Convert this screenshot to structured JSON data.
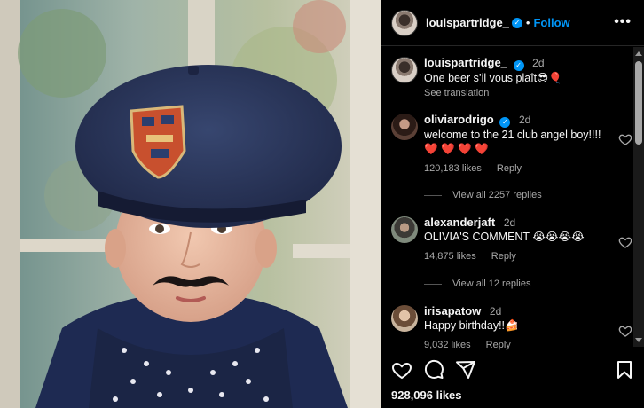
{
  "post": {
    "username": "louispartridge_",
    "follow_label": "Follow",
    "more_label": "•••",
    "likes": "928,096 likes"
  },
  "caption": {
    "username": "louispartridge_",
    "time": "2d",
    "text": "One beer s’il vous plaît😎🎈",
    "see_translation": "See translation"
  },
  "comments": [
    {
      "username": "oliviarodrigo",
      "time": "2d",
      "text": "welcome to the 21 club angel boy!!!! ❤️ ❤️ ❤️ ❤️",
      "likes": "120,183 likes",
      "reply_label": "Reply",
      "view_replies": "View all 2257 replies"
    },
    {
      "username": "alexanderjaft",
      "time": "2d",
      "text": "OLIVIA'S COMMENT 😭😭😭😭",
      "likes": "14,875 likes",
      "reply_label": "Reply",
      "view_replies": "View all 12 replies"
    },
    {
      "username": "irisapatow",
      "time": "2d",
      "text": "Happy birthday!!🍰",
      "likes": "9,032 likes",
      "reply_label": "Reply"
    }
  ],
  "icons": {
    "like": "heart-icon",
    "comment": "comment-icon",
    "share": "share-icon",
    "save": "bookmark-icon"
  },
  "colors": {
    "accent": "#0095f6",
    "muted": "#a8a8a8",
    "background": "#000000"
  }
}
